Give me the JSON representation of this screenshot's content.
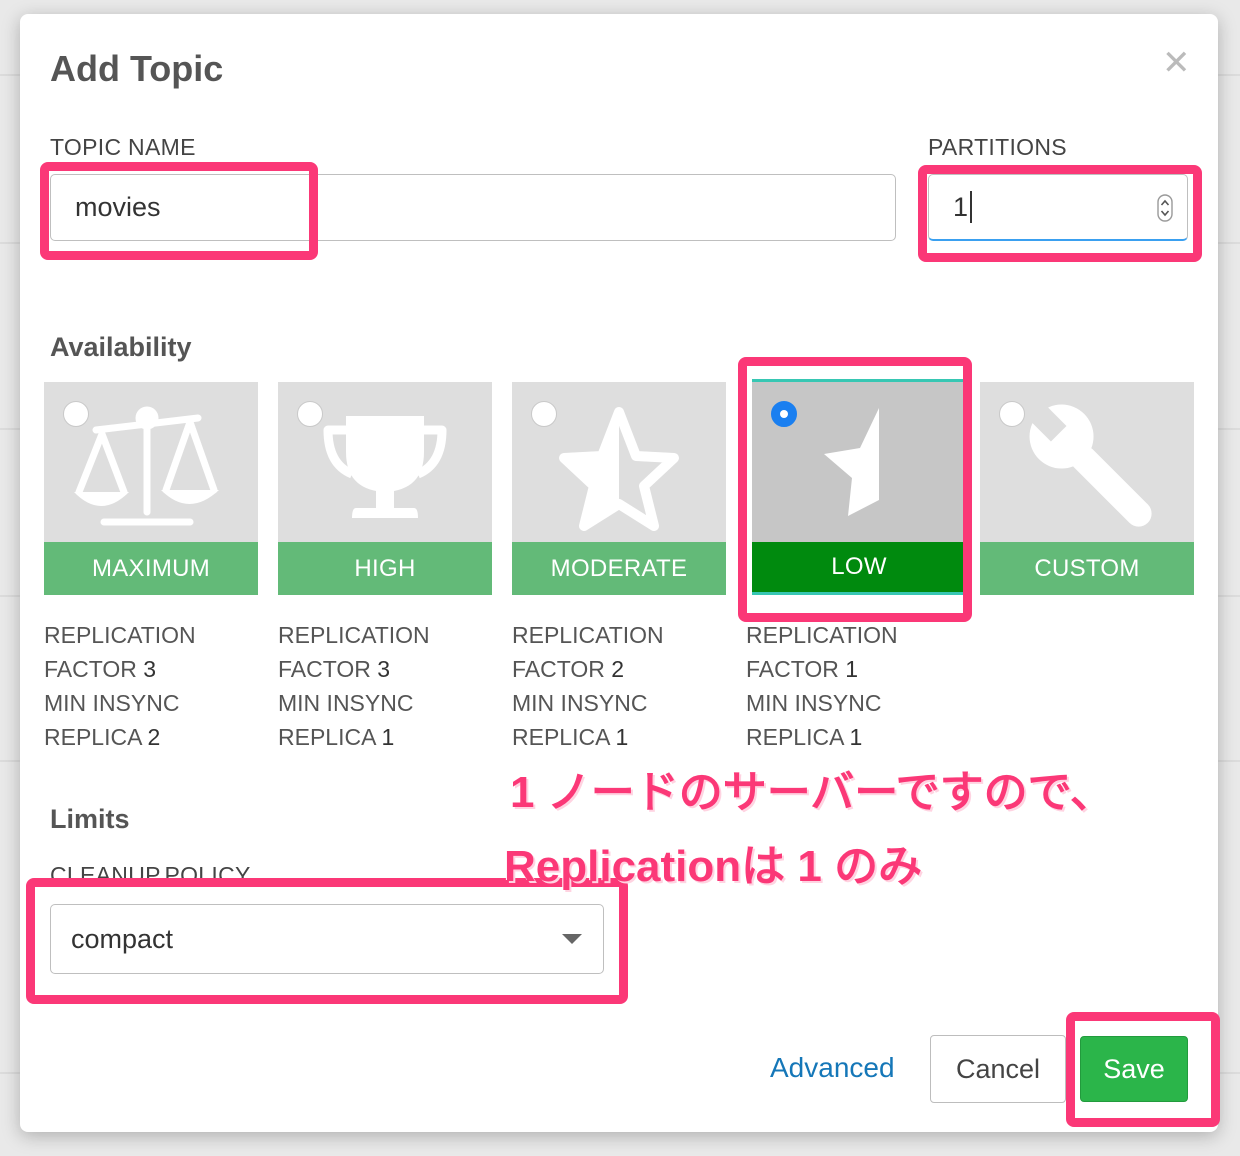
{
  "dialog": {
    "title": "Add Topic",
    "close_icon": "close-icon"
  },
  "topic_name": {
    "label": "TOPIC NAME",
    "value": "movies"
  },
  "partitions": {
    "label": "PARTITIONS",
    "value": "1"
  },
  "availability": {
    "heading": "Availability",
    "options": [
      {
        "label": "MAXIMUM",
        "icon": "scale-icon",
        "selected": false,
        "desc": [
          "REPLICATION",
          "FACTOR",
          "3",
          "MIN INSYNC",
          "REPLICA",
          "2"
        ]
      },
      {
        "label": "HIGH",
        "icon": "trophy-icon",
        "selected": false,
        "desc": [
          "REPLICATION",
          "FACTOR",
          "3",
          "MIN INSYNC",
          "REPLICA",
          "1"
        ]
      },
      {
        "label": "MODERATE",
        "icon": "star-icon",
        "selected": false,
        "desc": [
          "REPLICATION",
          "FACTOR",
          "2",
          "MIN INSYNC",
          "REPLICA",
          "1"
        ]
      },
      {
        "label": "LOW",
        "icon": "half-star-icon",
        "selected": true,
        "desc": [
          "REPLICATION",
          "FACTOR",
          "1",
          "MIN INSYNC",
          "REPLICA",
          "1"
        ]
      },
      {
        "label": "CUSTOM",
        "icon": "wrench-icon",
        "selected": false,
        "desc": []
      }
    ]
  },
  "limits": {
    "heading": "Limits",
    "cleanup_label": "CLEANUP.POLICY",
    "cleanup_value": "compact"
  },
  "annotation": {
    "line1": "1 ノードのサーバーですので、",
    "line2": "Replicationは 1 のみ",
    "color": "#fb3877"
  },
  "footer": {
    "advanced": "Advanced",
    "cancel": "Cancel",
    "save": "Save"
  },
  "colors": {
    "tile_band": "#63ba78",
    "tile_band_selected": "#008a0e",
    "save_button": "#2bb54a",
    "link": "#1577b8",
    "radio_selected": "#1a7ff0"
  }
}
